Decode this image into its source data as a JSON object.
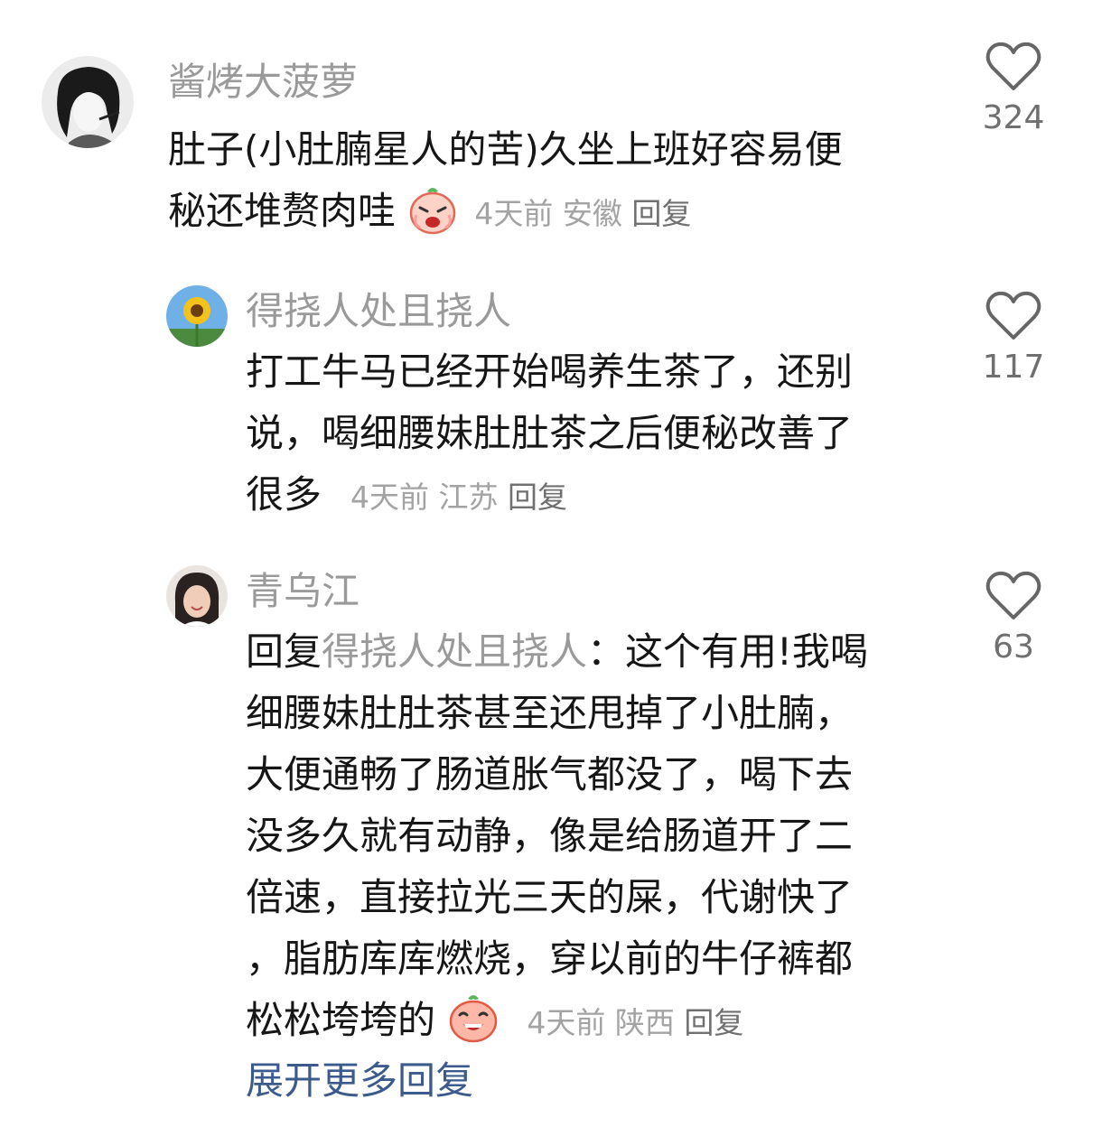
{
  "comments": [
    {
      "username": "酱烤大菠萝",
      "lines": [
        "肚子(小肚腩星人的苦)久坐上班好容易便",
        "秘还堆赘肉哇"
      ],
      "time": "4天前",
      "location": "安徽",
      "reply_label": "回复",
      "likes": "324",
      "emoji": "crying-peach-emoji"
    },
    {
      "username": "得挠人处且挠人",
      "lines": [
        "打工牛马已经开始喝养生茶了，还别",
        "说，喝细腰妹肚肚茶之后便秘改善了",
        "很多"
      ],
      "time": "4天前",
      "location": "江苏",
      "reply_label": "回复",
      "likes": "117"
    },
    {
      "username": "青乌江",
      "reply_prefix": "回复",
      "reply_target": "得挠人处且挠人",
      "reply_colon": "：",
      "lines": [
        "这个有用!我喝",
        "细腰妹肚肚茶甚至还甩掉了小肚腩，",
        "大便通畅了肠道胀气都没了，喝下去",
        "没多久就有动静，像是给肠道开了二",
        "倍速，直接拉光三天的屎，代谢快了",
        "，脂肪库库燃烧，穿以前的牛仔裤都",
        "松松垮垮的"
      ],
      "time": "4天前",
      "location": "陕西",
      "reply_label": "回复",
      "likes": "63",
      "emoji": "laughing-peach-emoji",
      "expand_label": "展开更多回复"
    }
  ]
}
